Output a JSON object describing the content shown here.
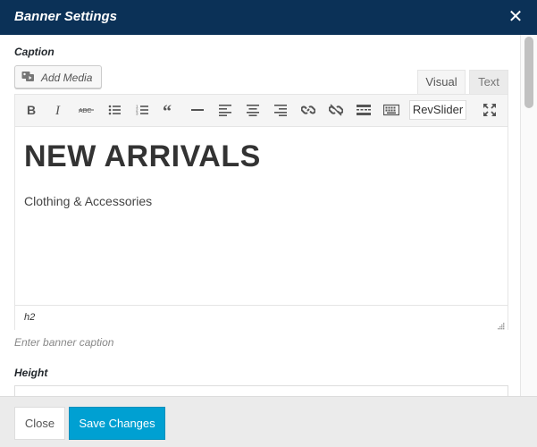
{
  "dialog": {
    "title": "Banner Settings",
    "close_icon": "close-icon"
  },
  "caption": {
    "label": "Caption",
    "add_media_label": "Add Media",
    "tabs": [
      {
        "label": "Visual",
        "active": true
      },
      {
        "label": "Text",
        "active": false
      }
    ],
    "toolbar": {
      "buttons": [
        "bold-icon",
        "italic-icon",
        "strikethrough-icon",
        "bulleted-list-icon",
        "numbered-list-icon",
        "blockquote-icon",
        "horizontal-line-icon",
        "align-left-icon",
        "align-center-icon",
        "align-right-icon",
        "link-icon",
        "unlink-icon",
        "read-more-icon",
        "keyboard-icon",
        "fullscreen-icon"
      ],
      "revslider_label": "RevSlider"
    },
    "content": {
      "heading": "NEW ARRIVALS",
      "paragraph": "Clothing & Accessories"
    },
    "status_path": "h2",
    "hint": "Enter banner caption"
  },
  "height": {
    "label": "Height",
    "value": ""
  },
  "footer": {
    "close_label": "Close",
    "save_label": "Save Changes"
  },
  "colors": {
    "titlebar": "#0b3157",
    "primary_button": "#00a0d2"
  }
}
